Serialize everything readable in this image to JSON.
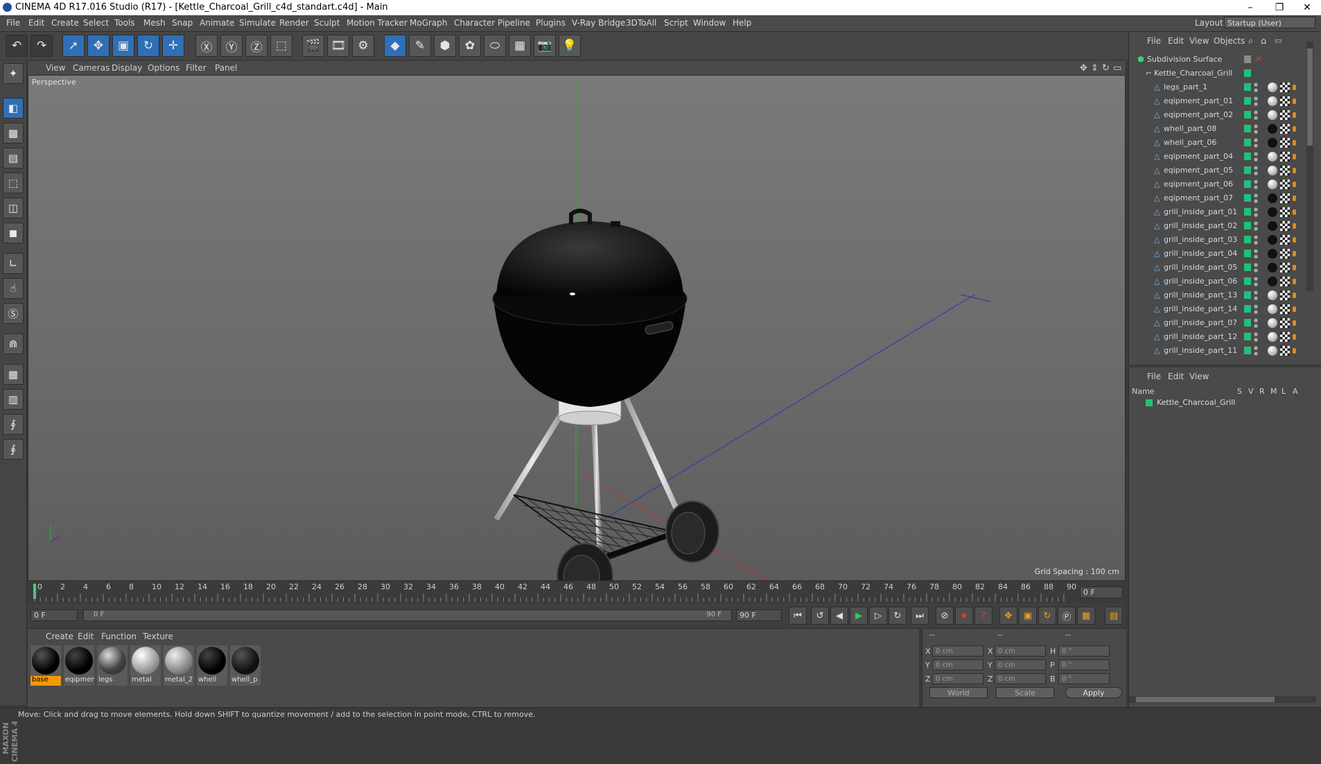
{
  "window": {
    "title": "CINEMA 4D R17.016 Studio (R17) - [Kettle_Charcoal_Grill_c4d_standart.c4d] - Main",
    "minimize": "–",
    "maximize": "❐",
    "close": "✕"
  },
  "menu": [
    "File",
    "Edit",
    "Create",
    "Select",
    "Tools",
    "Mesh",
    "Snap",
    "Animate",
    "Simulate",
    "Render",
    "Sculpt",
    "Motion Tracker",
    "MoGraph",
    "Character",
    "Pipeline",
    "Plugins",
    "V-Ray Bridge",
    "3DToAll",
    "Script",
    "Window",
    "Help"
  ],
  "layout": {
    "label": "Layout:",
    "value": "Startup (User)"
  },
  "viewport": {
    "menu": [
      "View",
      "Cameras",
      "Display",
      "Options",
      "Filter",
      "Panel"
    ],
    "label": "Perspective",
    "grid_spacing": "Grid Spacing : 100 cm"
  },
  "timeline": {
    "ticks": [
      "0",
      "2",
      "4",
      "6",
      "8",
      "10",
      "12",
      "14",
      "16",
      "18",
      "20",
      "22",
      "24",
      "26",
      "28",
      "30",
      "32",
      "34",
      "36",
      "38",
      "40",
      "42",
      "44",
      "46",
      "48",
      "50",
      "52",
      "54",
      "56",
      "58",
      "60",
      "62",
      "64",
      "66",
      "68",
      "70",
      "72",
      "74",
      "76",
      "78",
      "80",
      "82",
      "84",
      "86",
      "88",
      "90"
    ],
    "current_frame": "0 F",
    "start": "0 F",
    "range_start": "0 F",
    "range_end": "90 F",
    "end": "90 F"
  },
  "material_manager": {
    "menu": [
      "Create",
      "Edit",
      "Function",
      "Texture"
    ],
    "materials": [
      {
        "name": "base",
        "selected": true
      },
      {
        "name": "eqipment",
        "selected": false
      },
      {
        "name": "legs",
        "selected": false
      },
      {
        "name": "metal",
        "selected": false
      },
      {
        "name": "metal_2",
        "selected": false
      },
      {
        "name": "whell",
        "selected": false
      },
      {
        "name": "whell_p",
        "selected": false
      }
    ]
  },
  "coordinates": {
    "headers": [
      "--",
      "--",
      "--"
    ],
    "rows": [
      {
        "a": "X",
        "av": "0 cm",
        "b": "X",
        "bv": "0 cm",
        "c": "H",
        "cv": "0 °"
      },
      {
        "a": "Y",
        "av": "0 cm",
        "b": "Y",
        "bv": "0 cm",
        "c": "P",
        "cv": "0 °"
      },
      {
        "a": "Z",
        "av": "0 cm",
        "b": "Z",
        "bv": "0 cm",
        "c": "B",
        "cv": "0 °"
      }
    ],
    "world": "World",
    "scale": "Scale",
    "apply": "Apply"
  },
  "object_manager": {
    "menu": [
      "File",
      "Edit",
      "View",
      "Objects"
    ],
    "root": "Subdivision Surface",
    "group": "Kettle_Charcoal_Grill",
    "children": [
      "legs_part_1",
      "eqipment_part_01",
      "eqipment_part_02",
      "whell_part_08",
      "whell_part_06",
      "eqipment_part_04",
      "eqipment_part_05",
      "eqipment_part_06",
      "eqipment_part_07",
      "grill_inside_part_01",
      "grill_inside_part_02",
      "grill_inside_part_03",
      "grill_inside_part_04",
      "grill_inside_part_05",
      "grill_inside_part_06",
      "grill_inside_part_13",
      "grill_inside_part_14",
      "grill_inside_part_07",
      "grill_inside_part_12",
      "grill_inside_part_11"
    ]
  },
  "attribute_manager": {
    "menu": [
      "File",
      "Edit",
      "View"
    ],
    "columns": [
      "Name",
      "S",
      "V",
      "R",
      "M",
      "L",
      "A"
    ],
    "item": "Kettle_Charcoal_Grill"
  },
  "status": "Move: Click and drag to move elements. Hold down SHIFT to quantize movement / add to the selection in point mode, CTRL to remove."
}
